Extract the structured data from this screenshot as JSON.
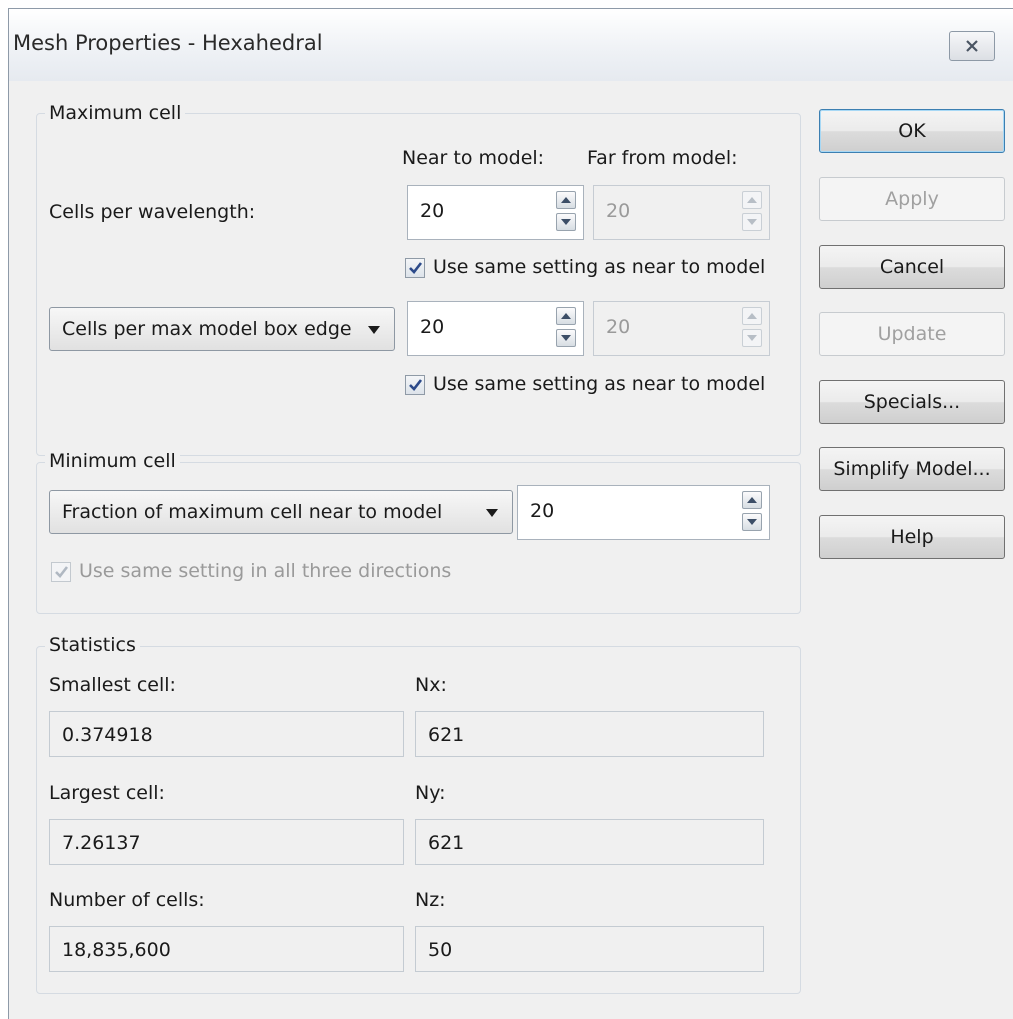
{
  "window": {
    "title": "Mesh Properties - Hexahedral"
  },
  "maximum_cell": {
    "label": "Maximum cell",
    "near_header": "Near to model:",
    "far_header": "Far from model:",
    "cells_per_wavelength": {
      "label": "Cells per wavelength:",
      "near_value": "20",
      "far_value": "20",
      "same_setting_label": "Use same setting as near to model",
      "same_setting_checked": true
    },
    "box_edge": {
      "selected": "Cells per max model box edge",
      "near_value": "20",
      "far_value": "20",
      "same_setting_label": "Use same setting as near to model",
      "same_setting_checked": true
    }
  },
  "minimum_cell": {
    "label": "Minimum cell",
    "selected": "Fraction of maximum cell near to model",
    "value": "20",
    "all_directions_label": "Use same setting in all three directions",
    "all_directions_checked": true
  },
  "statistics": {
    "label": "Statistics",
    "smallest_label": "Smallest cell:",
    "smallest_value": "0.374918",
    "largest_label": "Largest cell:",
    "largest_value": "7.26137",
    "count_label": "Number of cells:",
    "count_value": "18,835,600",
    "nx_label": "Nx:",
    "nx_value": "621",
    "ny_label": "Ny:",
    "ny_value": "621",
    "nz_label": "Nz:",
    "nz_value": "50"
  },
  "buttons": {
    "ok": "OK",
    "apply": "Apply",
    "cancel": "Cancel",
    "update": "Update",
    "specials": "Specials...",
    "simplify": "Simplify Model...",
    "help": "Help"
  },
  "icons": {
    "close": "close-icon",
    "spin_up": "spin-up-icon",
    "spin_down": "spin-down-icon",
    "dropdown": "chevron-down-icon",
    "check": "checkmark-icon"
  },
  "colors": {
    "check_mark": "#2c4a8a",
    "default_button_border": "#3c7fb1"
  }
}
